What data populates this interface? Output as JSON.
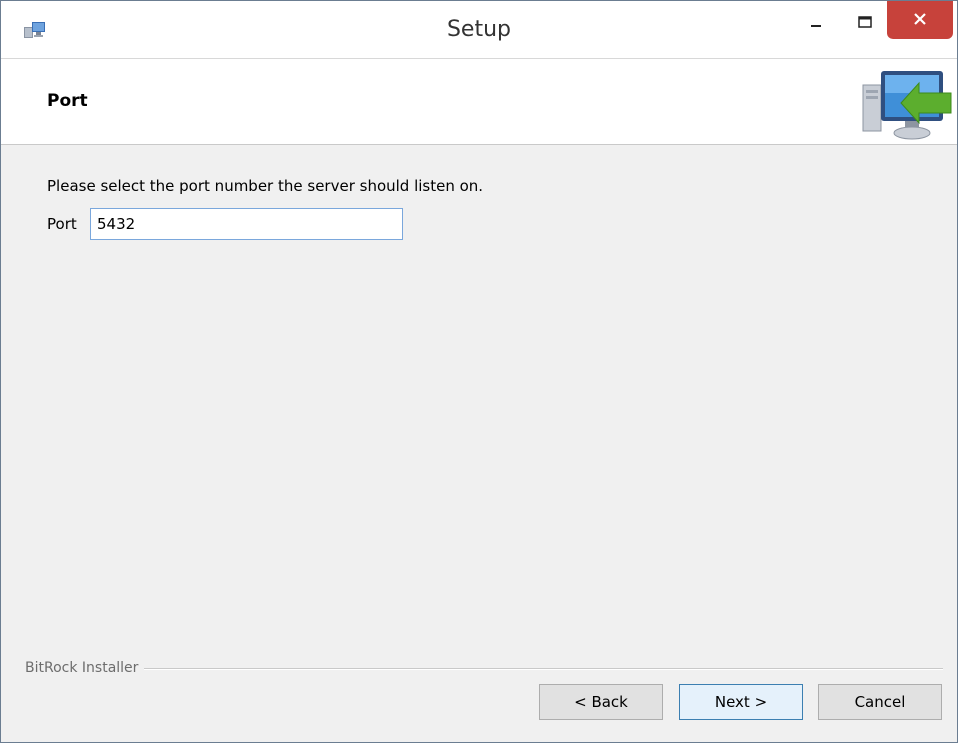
{
  "window": {
    "title": "Setup"
  },
  "header": {
    "title": "Port"
  },
  "content": {
    "instructions": "Please select the port number the server should listen on.",
    "port_label": "Port",
    "port_value": "5432"
  },
  "footer": {
    "installer_label": "BitRock Installer",
    "back_label": "< Back",
    "next_label": "Next >",
    "cancel_label": "Cancel"
  },
  "colors": {
    "close_button": "#c7423b",
    "default_button_border": "#3c7fb1",
    "input_border": "#7aa7dc"
  },
  "icons": {
    "app": "installer-app-icon",
    "header": "computer-with-green-arrow-icon",
    "minimize": "minimize-icon",
    "maximize": "maximize-icon",
    "close": "close-icon"
  }
}
